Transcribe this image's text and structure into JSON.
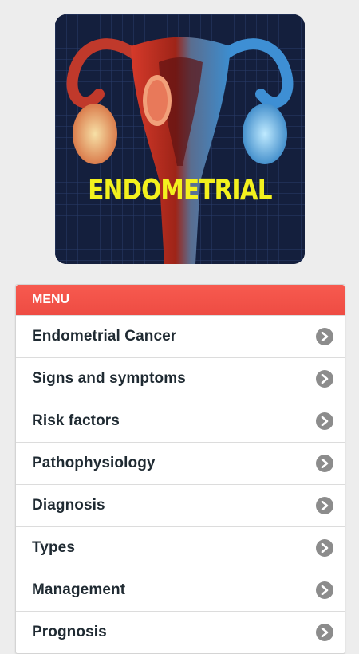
{
  "hero": {
    "title": "ENDOMETRIAL",
    "image_alt": "endometrial-anatomy-illustration"
  },
  "menu": {
    "header": "MENU",
    "items": [
      {
        "label": "Endometrial Cancer",
        "icon": "chevron-right-icon"
      },
      {
        "label": "Signs and symptoms",
        "icon": "chevron-right-icon"
      },
      {
        "label": "Risk factors",
        "icon": "chevron-right-icon"
      },
      {
        "label": "Pathophysiology",
        "icon": "chevron-right-icon"
      },
      {
        "label": "Diagnosis",
        "icon": "chevron-right-icon"
      },
      {
        "label": "Types",
        "icon": "chevron-right-icon"
      },
      {
        "label": "Management",
        "icon": "chevron-right-icon"
      },
      {
        "label": "Prognosis",
        "icon": "chevron-right-icon"
      }
    ]
  },
  "colors": {
    "header_red": "#f0524a",
    "background": "#ededed",
    "title_yellow": "#f3f11e"
  }
}
